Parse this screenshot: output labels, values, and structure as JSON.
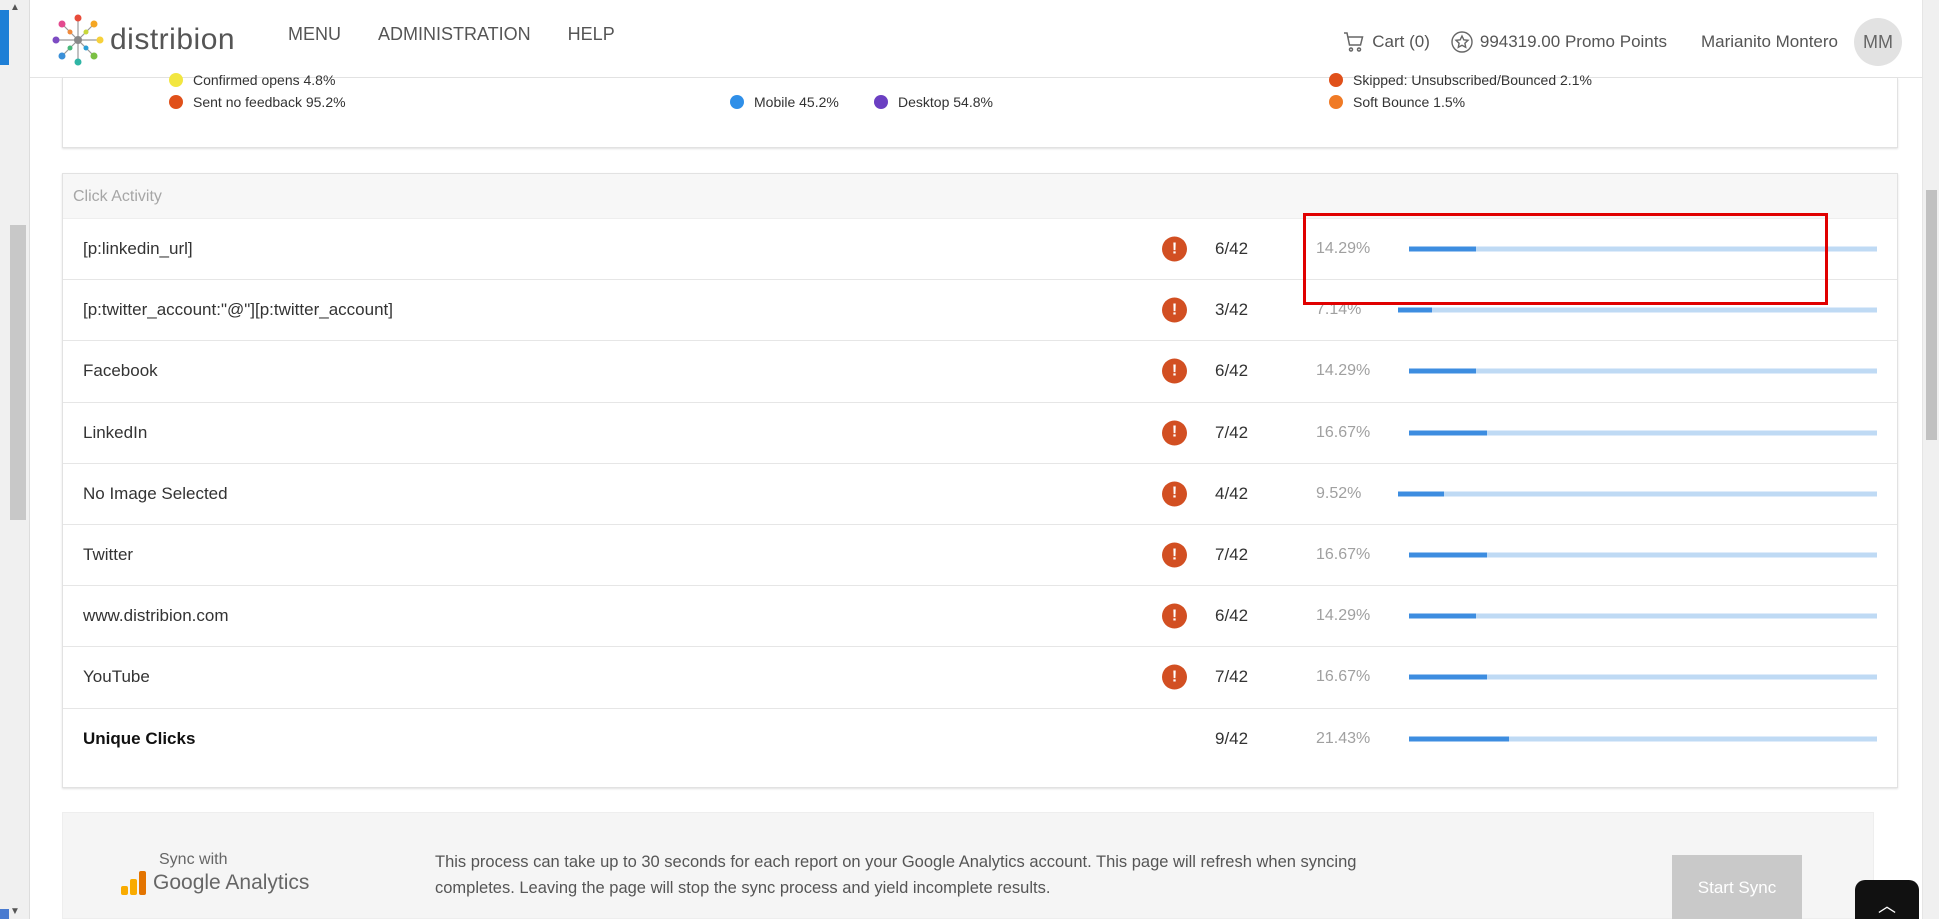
{
  "header": {
    "logo_text": "distribion",
    "nav": [
      "MENU",
      "ADMINISTRATION",
      "HELP"
    ],
    "cart_label": "Cart (0)",
    "promo_label": "994319.00 Promo Points",
    "user_name": "Marianito Montero",
    "avatar_initials": "MM"
  },
  "stats_legend": [
    {
      "label": "Confirmed opens 4.8%",
      "color": "#f2e640"
    },
    {
      "label": "Sent no feedback 95.2%",
      "color": "#e0501a"
    },
    {
      "label": "Mobile 45.2%",
      "color": "#2f8fe8"
    },
    {
      "label": "Desktop 54.8%",
      "color": "#6b3fc2"
    },
    {
      "label": "Skipped: Unsubscribed/Bounced 2.1%",
      "color": "#e0501a"
    },
    {
      "label": "Soft Bounce 1.5%",
      "color": "#f07a25"
    }
  ],
  "click_activity": {
    "title": "Click Activity",
    "rows": [
      {
        "label": "[p:linkedin_url]",
        "count": "6/42",
        "pct": "14.29%",
        "fraction": 0.1429,
        "warn": true
      },
      {
        "label": "[p:twitter_account:\"@\"][p:twitter_account]",
        "count": "3/42",
        "pct": "7.14%",
        "fraction": 0.0714,
        "warn": true
      },
      {
        "label": "Facebook",
        "count": "6/42",
        "pct": "14.29%",
        "fraction": 0.1429,
        "warn": true
      },
      {
        "label": "LinkedIn",
        "count": "7/42",
        "pct": "16.67%",
        "fraction": 0.1667,
        "warn": true
      },
      {
        "label": "No Image Selected",
        "count": "4/42",
        "pct": "9.52%",
        "fraction": 0.0952,
        "warn": true
      },
      {
        "label": "Twitter",
        "count": "7/42",
        "pct": "16.67%",
        "fraction": 0.1667,
        "warn": true
      },
      {
        "label": "www.distribion.com",
        "count": "6/42",
        "pct": "14.29%",
        "fraction": 0.1429,
        "warn": true
      },
      {
        "label": "YouTube",
        "count": "7/42",
        "pct": "16.67%",
        "fraction": 0.1667,
        "warn": true
      },
      {
        "label": "Unique Clicks",
        "count": "9/42",
        "pct": "21.43%",
        "fraction": 0.2143,
        "warn": false,
        "bold": true
      }
    ]
  },
  "sync": {
    "sync_with": "Sync with",
    "ga_name": "Google Analytics",
    "message": "This process can take up to 30 seconds for each report on your Google Analytics account. This page will refresh when syncing completes. Leaving the page will stop the sync process and yield incomplete results.",
    "button": "Start Sync"
  },
  "warn_symbol": "!",
  "colors": {
    "accent": "#3d8de0",
    "warning": "#d24f22",
    "highlight": "#e00000"
  }
}
